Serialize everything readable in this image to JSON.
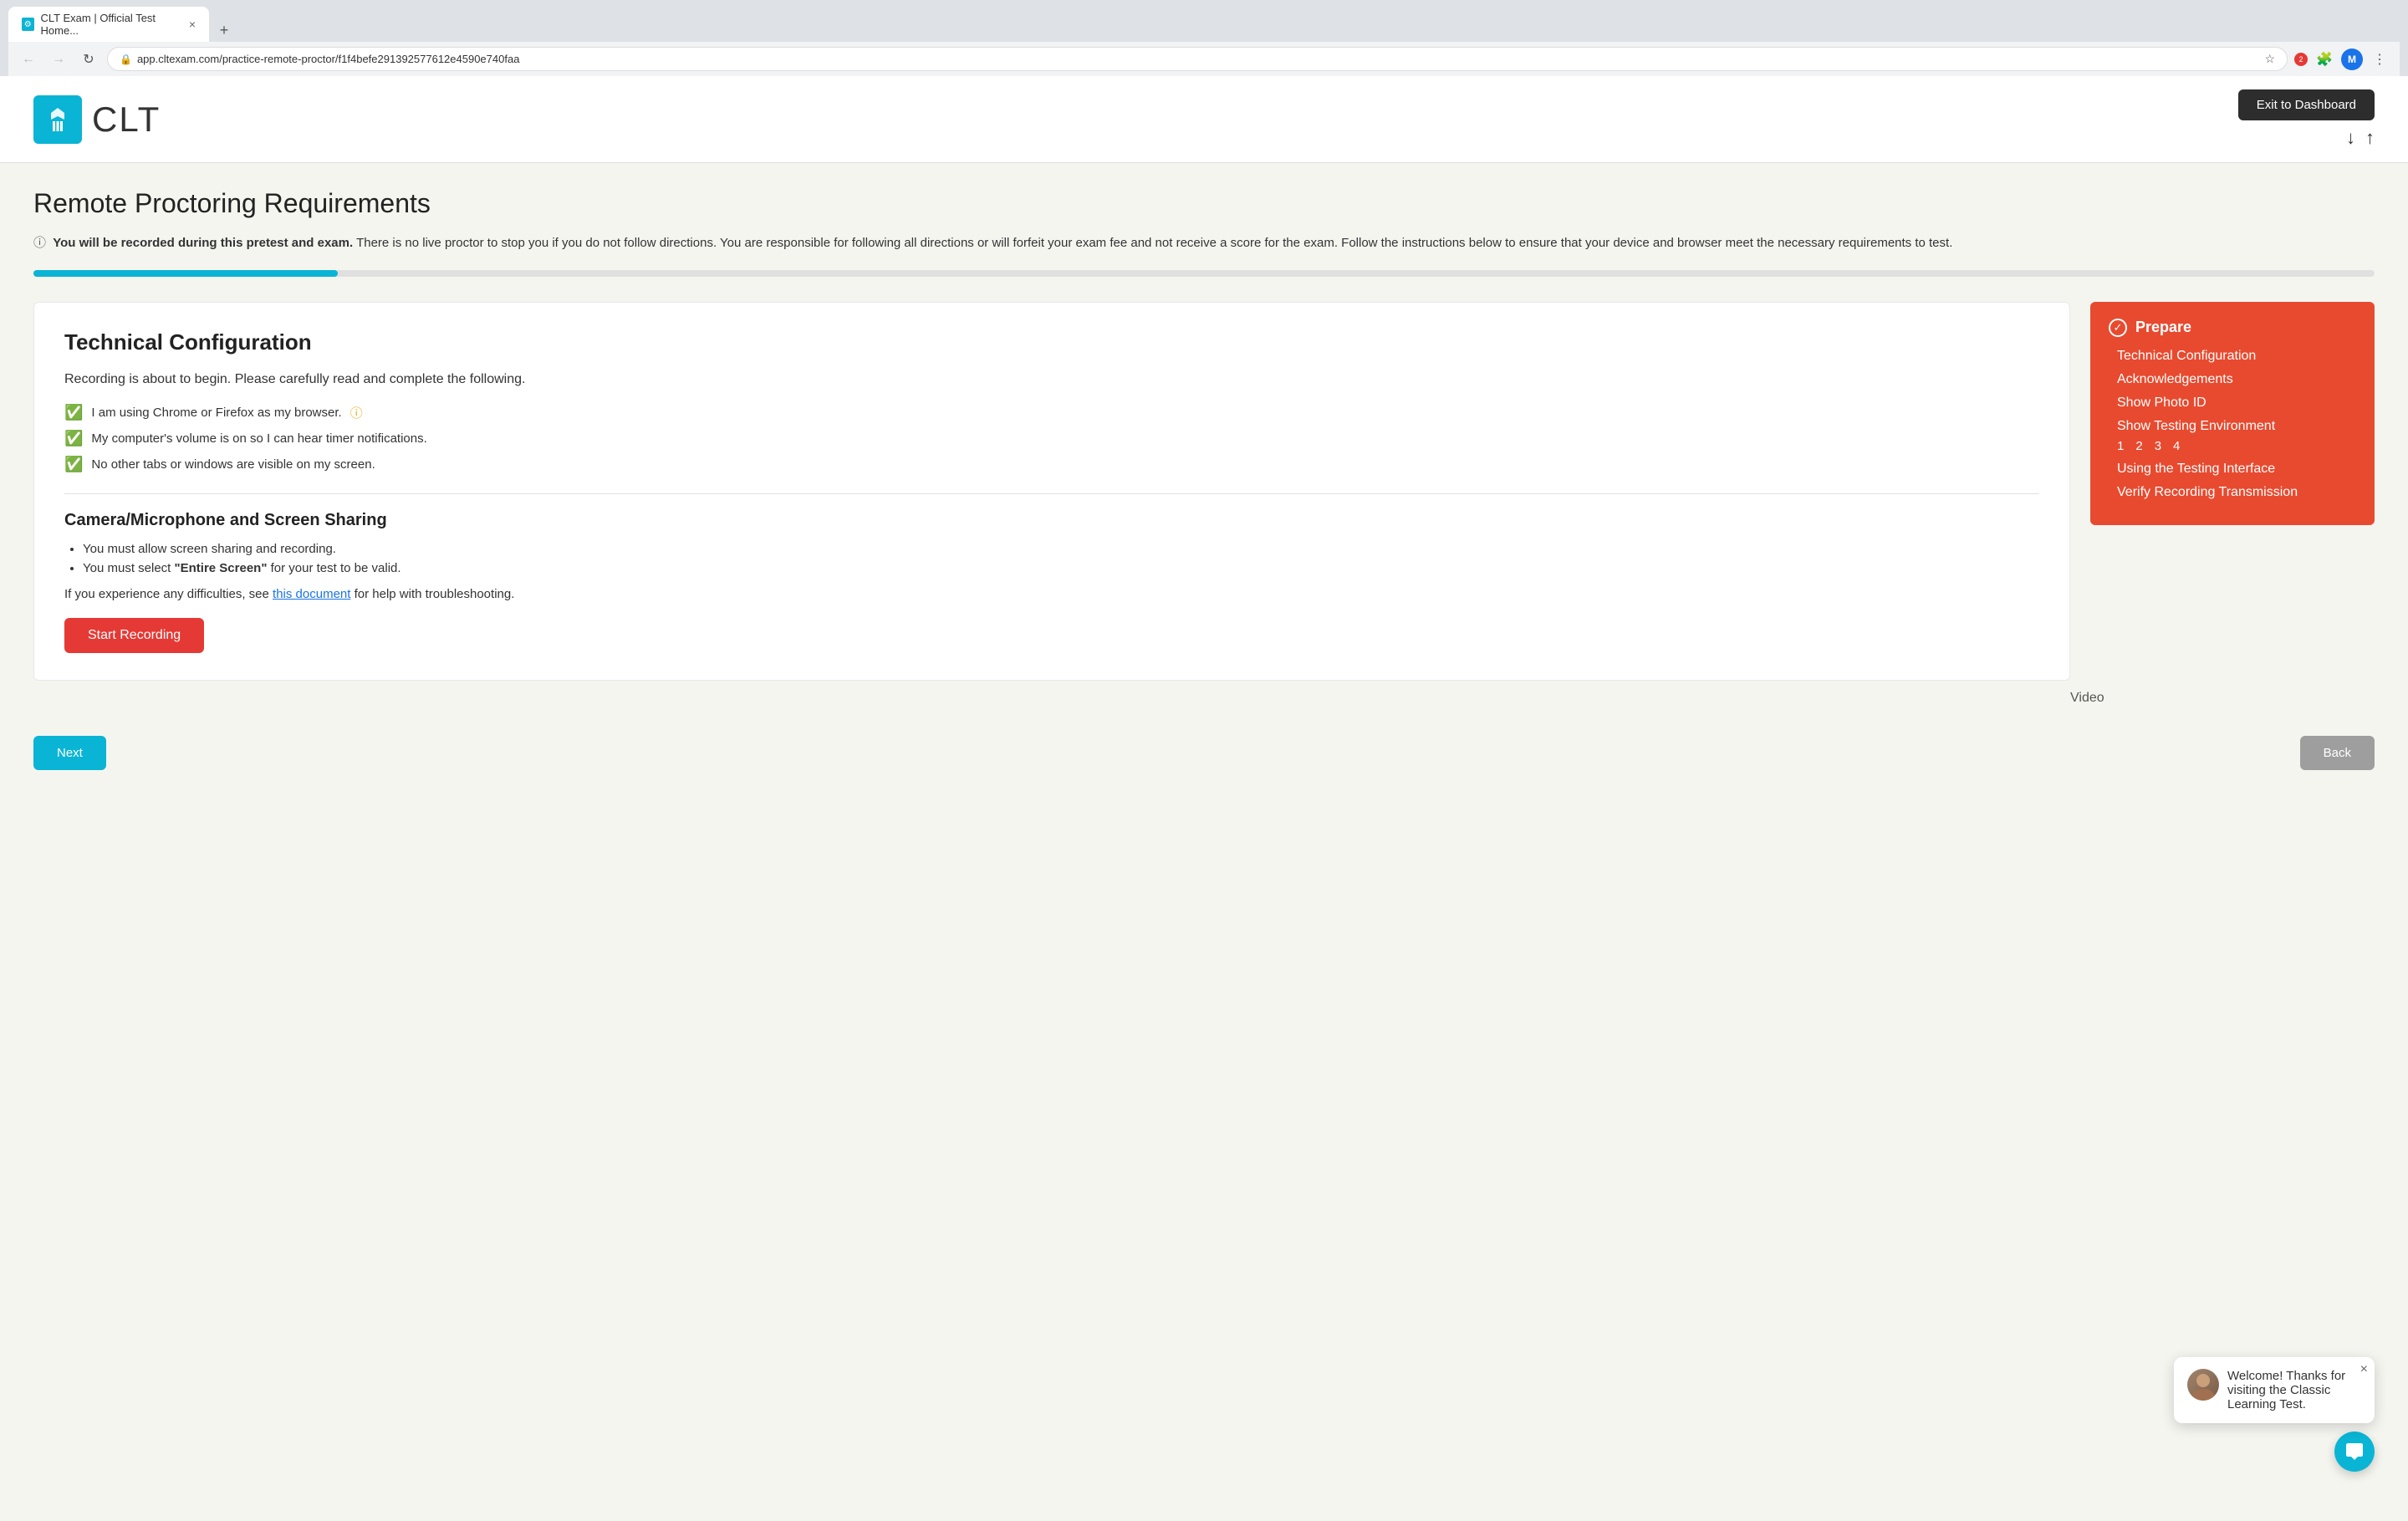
{
  "browser": {
    "tab_title": "CLT Exam | Official Test Home...",
    "tab_new_label": "+",
    "url": "app.cltexam.com/practice-remote-proctor/f1f4befe291392577612e4590e740faa",
    "profile_initial": "M"
  },
  "header": {
    "logo_text": "CLT",
    "exit_button_label": "Exit to Dashboard",
    "nav_down_arrow": "↓",
    "nav_up_arrow": "↑"
  },
  "page": {
    "title": "Remote Proctoring Requirements",
    "warning_bold": "You will be recorded during this pretest and exam.",
    "warning_rest": " There is no live proctor to stop you if you do not follow directions. You are responsible for following all directions or will forfeit your exam fee and not receive a score for the exam. Follow the instructions below to ensure that your device and browser meet the necessary requirements to test.",
    "progress_percent": 13
  },
  "main": {
    "section_title": "Technical Configuration",
    "section_subtitle": "Recording is about to begin. Please carefully read and complete the following.",
    "checklist": [
      {
        "text": "I am using Chrome or Firefox as my browser.",
        "has_info": true
      },
      {
        "text": "My computer's volume is on so I can hear timer notifications.",
        "has_info": false
      },
      {
        "text": "No other tabs or windows are visible on my screen.",
        "has_info": false
      }
    ],
    "camera_section_title": "Camera/Microphone and Screen Sharing",
    "bullet_items": [
      "You must allow screen sharing and recording.",
      "You must select \"Entire Screen\" for your test to be valid."
    ],
    "help_text_prefix": "If you experience any difficulties, see ",
    "help_link_text": "this document",
    "help_text_suffix": " for help with troubleshooting.",
    "start_recording_label": "Start Recording"
  },
  "sidebar": {
    "prepare_label": "Prepare",
    "nav_items": [
      {
        "label": "Technical Configuration"
      },
      {
        "label": "Acknowledgements"
      },
      {
        "label": "Show Photo ID"
      },
      {
        "label": "Show Testing Environment"
      }
    ],
    "env_steps": [
      "1",
      "2",
      "3",
      "4"
    ],
    "more_items": [
      {
        "label": "Using the Testing Interface"
      },
      {
        "label": "Verify Recording Transmission"
      }
    ]
  },
  "video_label": "Video",
  "chat": {
    "message": "Welcome! Thanks for visiting the Classic Learning Test.",
    "close_label": "×"
  },
  "icons": {
    "check": "✓",
    "checkbox_checked": "✅",
    "info": "ⓘ",
    "down_arrow": "↓",
    "up_arrow": "↑",
    "chat_icon": "💬",
    "back": "←",
    "forward": "→",
    "reload": "↻",
    "star": "☆",
    "menu": "⋮",
    "extension": "🧩",
    "close": "×"
  }
}
